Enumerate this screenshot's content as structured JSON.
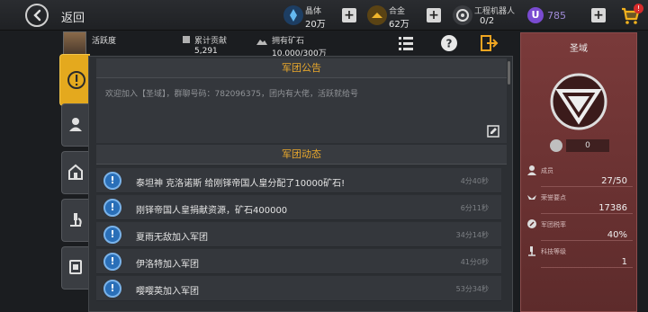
{
  "topbar": {
    "back_label": "返回",
    "resources": [
      {
        "label": "晶体",
        "value": "20万",
        "icon": "crystal-icon",
        "color": "#4aa3e8"
      },
      {
        "label": "合金",
        "value": "62万",
        "icon": "alloy-icon",
        "color": "#e2a21c"
      },
      {
        "label": "工程机器人",
        "value": "0/2",
        "icon": "robot-icon",
        "color": "#e0e0e0"
      }
    ],
    "premium_value": "785",
    "cart_badge": "!"
  },
  "player": {
    "name": "活跃度",
    "contribution_label": "累计贡献",
    "contribution_value": "5,291",
    "ore_label": "拥有矿石",
    "ore_value": "10,000/300万"
  },
  "notice": {
    "title": "军团公告",
    "text": "欢迎加入【圣域】，群聊号码：782096375，团内有大佬，活跃就给号"
  },
  "dynamics": {
    "title": "军团动态",
    "items": [
      {
        "text": "泰坦神 克洛诺斯 给刚铎帝国人皇分配了10000矿石!",
        "time": "4分40秒"
      },
      {
        "text": "刚铎帝国人皇捐献资源，矿石400000",
        "time": "6分11秒"
      },
      {
        "text": "夏雨无敌加入军团",
        "time": "34分14秒"
      },
      {
        "text": "伊洛特加入军团",
        "time": "41分0秒"
      },
      {
        "text": "嘤嘤英加入军团",
        "time": "53分34秒"
      }
    ]
  },
  "legion": {
    "name": "圣域",
    "cost_value": "0",
    "stats": [
      {
        "label": "成员",
        "value": "27/50"
      },
      {
        "label": "荣誉要点",
        "value": "17386"
      },
      {
        "label": "军团税率",
        "value": "40%"
      },
      {
        "label": "科技等级",
        "value": "1"
      }
    ]
  }
}
